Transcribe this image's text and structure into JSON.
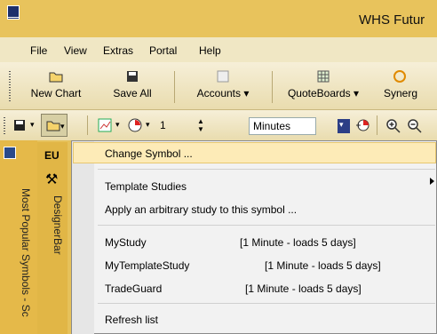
{
  "window": {
    "title": "WHS Futur"
  },
  "menubar": {
    "items": [
      "File",
      "View",
      "Extras",
      "Portal",
      "Help"
    ]
  },
  "toolbar": {
    "new_chart": "New Chart",
    "save_all": "Save All",
    "accounts": "Accounts",
    "quoteboards": "QuoteBoards",
    "synergy": "Synerg"
  },
  "chart_toolbar": {
    "interval_value": "1",
    "unit": "Minutes"
  },
  "sidebar": {
    "label": "Most Popular Symbols - Sc"
  },
  "panel": {
    "tab": "EU",
    "designer": "DesignerBar"
  },
  "dropdown": {
    "change_symbol": "Change Symbol ...",
    "template_studies": "Template Studies",
    "apply_study": "Apply an arbitrary study to this symbol ...",
    "studies": [
      {
        "name": "MyStudy",
        "detail": "[1 Minute - loads 5 days]"
      },
      {
        "name": "MyTemplateStudy",
        "detail": "[1 Minute - loads 5 days]"
      },
      {
        "name": "TradeGuard",
        "detail": "[1 Minute - loads 5 days]"
      }
    ],
    "refresh": "Refresh list"
  },
  "colors": {
    "title_bar": "#e8c35c",
    "toolbar": "#f0e7c4",
    "highlight": "#fdebb7"
  }
}
